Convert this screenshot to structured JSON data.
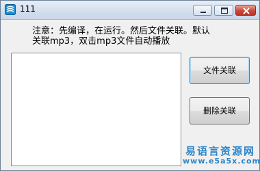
{
  "window": {
    "title": "111"
  },
  "notice": {
    "line1": "注意：先编译，在运行。然后文件关联。默认",
    "line2": "关联mp3，双击mp3文件自动播放"
  },
  "buttons": {
    "associate_label": "文件关联",
    "remove_label": "删除关联"
  },
  "watermark": {
    "site_name": "易语言资源网",
    "url": "www.e5a5x.com"
  },
  "colors": {
    "watermark": "#2c86c8",
    "close_button": "#c9483a",
    "focus_border": "#3c7fb1"
  }
}
